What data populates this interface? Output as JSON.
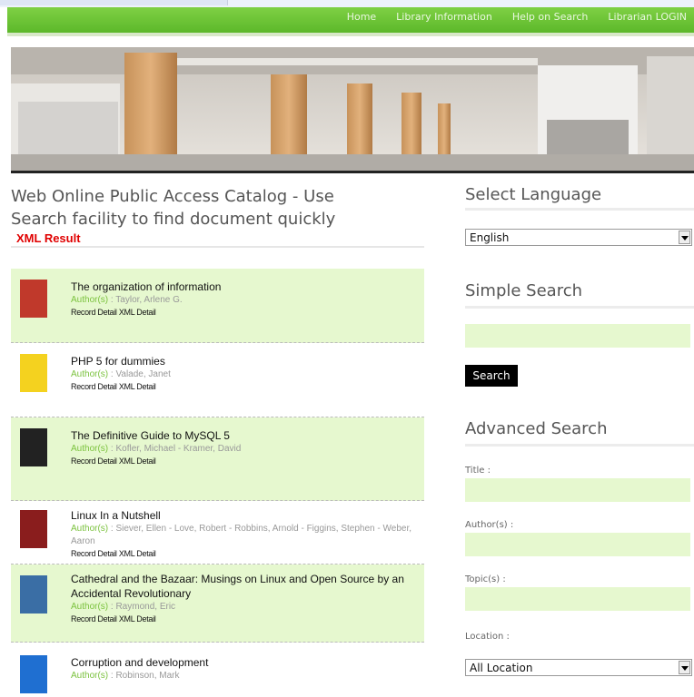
{
  "nav": {
    "items": [
      "Home",
      "Library Information",
      "Help on Search",
      "Librarian LOGIN"
    ]
  },
  "page": {
    "title_line1": "Web Online Public Access Catalog - Use",
    "title_line2": "Search facility to find document quickly",
    "xml_result": "XML Result"
  },
  "results": [
    {
      "title": "The organization of information",
      "author_label": "Author(s)",
      "authors": " : Taylor, Arlene G.",
      "links": "Record Detail  XML Detail",
      "cover_color": "#c0392b"
    },
    {
      "title": "PHP 5 for dummies",
      "author_label": "Author(s)",
      "authors": " : Valade, Janet",
      "links": "Record Detail  XML Detail",
      "cover_color": "#f4d21f"
    },
    {
      "title": "The Definitive Guide to MySQL 5",
      "author_label": "Author(s)",
      "authors": " : Kofler, Michael - Kramer, David",
      "links": "Record Detail  XML Detail",
      "cover_color": "#222222"
    },
    {
      "title": "Linux In a Nutshell",
      "author_label": "Author(s)",
      "authors": " : Siever, Ellen - Love, Robert - Robbins, Arnold - Figgins, Stephen - Weber, Aaron",
      "links": "Record Detail  XML Detail",
      "cover_color": "#8a1d1d"
    },
    {
      "title": "Cathedral and the Bazaar: Musings on Linux and Open Source by an Accidental Revolutionary",
      "author_label": "Author(s)",
      "authors": " : Raymond, Eric",
      "links": "Record Detail  XML Detail",
      "cover_color": "#3a6ea5"
    },
    {
      "title": "Corruption and development",
      "author_label": "Author(s)",
      "authors": " : Robinson, Mark",
      "links": "",
      "cover_color": "#1f6fd1"
    }
  ],
  "sidebar": {
    "language_heading": "Select Language",
    "language_value": "English",
    "simple_heading": "Simple Search",
    "search_button": "Search",
    "advanced_heading": "Advanced Search",
    "title_label": "Title :",
    "author_label": "Author(s) :",
    "topic_label": "Topic(s) :",
    "location_label": "Location :",
    "location_value": "All Location"
  },
  "colors": {
    "accent_green": "#6cc234",
    "alt_row": "#e6f8cf",
    "xml_red": "#e00000"
  }
}
